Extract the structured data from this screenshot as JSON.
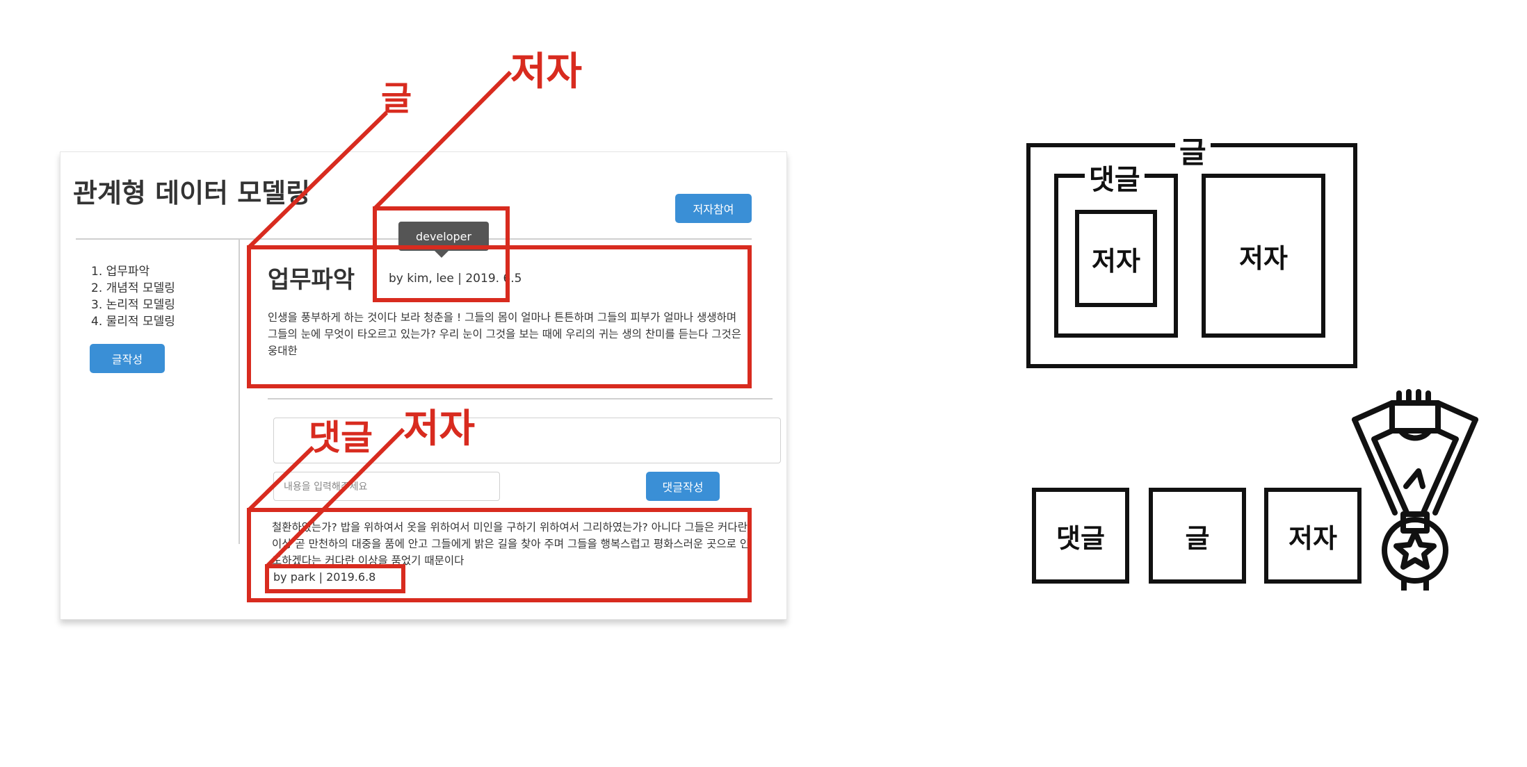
{
  "mockup": {
    "site_title": "관계형 데이터 모델링",
    "join_button": "저자참여",
    "toc": [
      "1. 업무파악",
      "2. 개념적 모델링",
      "3. 논리적 모델링",
      "4. 물리적 모델링"
    ],
    "write_button": "글작성",
    "post": {
      "title": "업무파악",
      "meta": "by kim, lee  |  2019. 6.5",
      "tooltip": "developer",
      "body": "인생을 풍부하게 하는 것이다 보라 청춘을 ! 그들의 몸이 얼마나 튼튼하며 그들의 피부가 얼마나 생생하며 그들의 눈에 무엇이 타오르고 있는가? 우리 눈이 그것을 보는 때에 우리의 귀는 생의 찬미를 듣는다 그것은 웅대한"
    },
    "comment_form": {
      "placeholder": "내용을 입력해주세요",
      "submit_button": "댓글작성"
    },
    "comment": {
      "body": "철환하였는가? 밥을 위하여서 옷을 위하여서 미인을 구하기 위하여서 그리하였는가? 아니다 그들은 커다란 이상 곧 만천하의 대중을 품에 안고 그들에게 밝은 길을 찾아 주며 그들을 행복스럽고 평화스러운 곳으로 인도하겠다는 커다란 이상을 품었기 때문이다",
      "meta": "by park | 2019.6.8"
    }
  },
  "annotations": {
    "post": "글",
    "author_top": "저자",
    "comment": "댓글",
    "author_comment": "저자"
  },
  "schema": {
    "outer": "글",
    "comment_group": "댓글",
    "inner_author": "저자",
    "right_author": "저자",
    "row": [
      "댓글",
      "글",
      "저자"
    ],
    "medal_icon": "medal-icon"
  },
  "colors": {
    "annotation_red": "#d82b1f",
    "button_blue": "#3a8fd6",
    "schema_black": "#111111"
  }
}
